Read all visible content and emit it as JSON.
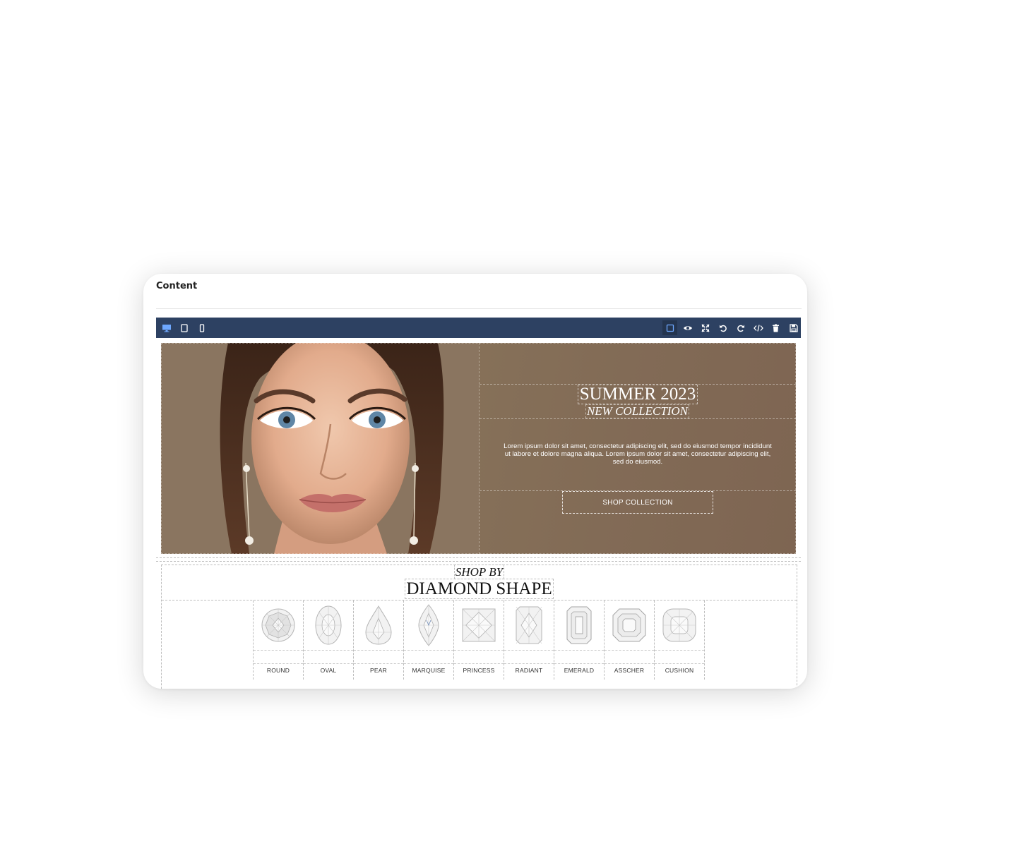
{
  "panel": {
    "label": "Content"
  },
  "toolbar": {
    "left": [
      {
        "icon": "desktop-icon",
        "label": "Desktop"
      },
      {
        "icon": "tablet-icon",
        "label": "Tablet"
      },
      {
        "icon": "mobile-icon",
        "label": "Mobile"
      }
    ],
    "right": [
      {
        "icon": "component-outline-icon"
      },
      {
        "icon": "preview-eye-icon"
      },
      {
        "icon": "fullscreen-icon"
      },
      {
        "icon": "undo-icon"
      },
      {
        "icon": "redo-icon"
      },
      {
        "icon": "code-icon"
      },
      {
        "icon": "trash-icon"
      },
      {
        "icon": "save-icon"
      }
    ],
    "accent": "#2d4162"
  },
  "hero": {
    "title": "SUMMER 2023",
    "subtitle": "NEW COLLECTION",
    "body": "Lorem ipsum dolor sit amet, consectetur adipiscing elit, sed do eiusmod tempor incididunt ut labore et dolore magna aliqua. Lorem ipsum dolor sit amet, consectetur adipiscing elit, sed do eiusmod.",
    "cta": "SHOP COLLECTION",
    "background": "#857059"
  },
  "shapes": {
    "kicker": "SHOP BY",
    "title": "DIAMOND SHAPE",
    "items": [
      {
        "label": "ROUND"
      },
      {
        "label": "OVAL"
      },
      {
        "label": "PEAR"
      },
      {
        "label": "MARQUISE"
      },
      {
        "label": "PRINCESS"
      },
      {
        "label": "RADIANT"
      },
      {
        "label": "EMERALD"
      },
      {
        "label": "ASSCHER"
      },
      {
        "label": "CUSHION"
      }
    ]
  }
}
